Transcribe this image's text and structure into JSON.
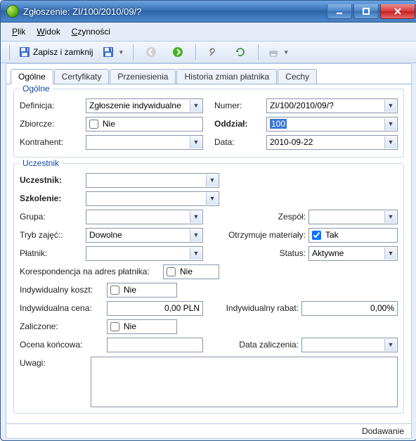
{
  "title": "Zgłoszenie: ZI/100/2010/09/?",
  "menu": {
    "file": "Plik",
    "view": "Widok",
    "actions": "Czynności"
  },
  "toolbar": {
    "save_close": "Zapisz i zamknij"
  },
  "tabs": [
    "Ogólne",
    "Certyfikaty",
    "Przeniesienia",
    "Historia zmian płatnika",
    "Cechy"
  ],
  "group_general": {
    "title": "Ogólne",
    "definition_lbl": "Definicja:",
    "definition_val": "Zgłoszenie indywidualne",
    "number_lbl": "Numer:",
    "number_val": "ZI/100/2010/09/?",
    "bulk_lbl": "Zbiorcze:",
    "bulk_text": "Nie",
    "branch_lbl": "Oddział:",
    "branch_val": "100",
    "contractor_lbl": "Kontrahent:",
    "contractor_val": "",
    "date_lbl": "Data:",
    "date_val": "2010-09-22"
  },
  "group_participant": {
    "title": "Uczestnik",
    "participant_lbl": "Uczestnik:",
    "training_lbl": "Szkolenie:",
    "group_lbl": "Grupa:",
    "team_lbl": "Zespół:",
    "mode_lbl": "Tryb zajęć::",
    "mode_val": "Dowolne",
    "materials_lbl": "Otrzymuje materiały:",
    "materials_text": "Tak",
    "payer_lbl": "Płatnik:",
    "status_lbl": "Status:",
    "status_val": "Aktywne",
    "corr_lbl": "Korespondencja na adres płatnika:",
    "corr_text": "Nie",
    "indcost_lbl": "Indywidualny koszt:",
    "indcost_text": "Nie",
    "indprice_lbl": "Indywidualna cena:",
    "indprice_val": "0,00 PLN",
    "indrebate_lbl": "Indywidualny rabat:",
    "indrebate_val": "0,00%",
    "credited_lbl": "Zaliczone:",
    "credited_text": "Nie",
    "finalgrade_lbl": "Ocena końcowa:",
    "finalgrade_val": "",
    "creditdate_lbl": "Data zaliczenia:",
    "creditdate_val": "",
    "remarks_lbl": "Uwagi:",
    "remarks_val": ""
  },
  "statusbar": "Dodawanie"
}
